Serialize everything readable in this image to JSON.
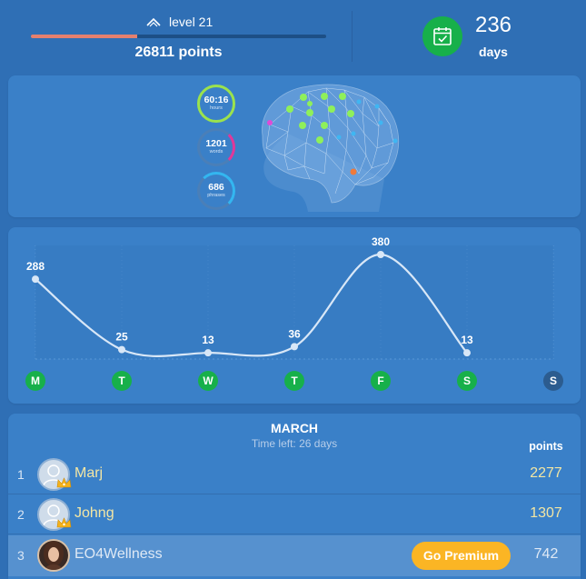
{
  "header": {
    "level_label": "level 21",
    "level_progress_percent": 36,
    "points_label": "26811 points",
    "streak_value": "236",
    "streak_unit": "days"
  },
  "brain_stats": [
    {
      "value": "60:16",
      "unit": "hours"
    },
    {
      "value": "1201",
      "unit": "words"
    },
    {
      "value": "686",
      "unit": "phrases"
    }
  ],
  "colors": {
    "background": "#2f6fb5",
    "card": "#3a80c8",
    "progress_fill": "#e5806f",
    "active_day": "#17b04a",
    "inactive_day": "#2c5c8f",
    "highlight_text": "#f3e6a4",
    "premium": "#fbb524"
  },
  "icons": {
    "level": "chevron-up-icon",
    "streak": "calendar-check-icon",
    "user_badge": "crown-icon",
    "avatar": "user-avatar-icon"
  },
  "chart_data": {
    "type": "line",
    "categories": [
      "M",
      "T",
      "W",
      "T",
      "F",
      "S",
      "S"
    ],
    "values": [
      288,
      25,
      13,
      36,
      380,
      13,
      null
    ],
    "value_labels": [
      "288",
      "25",
      "13",
      "36",
      "380",
      "13",
      ""
    ],
    "day_active": [
      true,
      true,
      true,
      true,
      true,
      true,
      false
    ],
    "title": "",
    "xlabel": "",
    "ylabel": "",
    "ylim": [
      0,
      380
    ],
    "grid": true
  },
  "leaderboard": {
    "month": "MARCH",
    "time_left": "Time left: 26 days",
    "column_label": "points",
    "premium_label": "Go Premium",
    "rows": [
      {
        "rank": "1",
        "name": "Marj",
        "score": "2277"
      },
      {
        "rank": "2",
        "name": "Johng",
        "score": "1307"
      },
      {
        "rank": "3",
        "name": "EO4Wellness",
        "score": "742"
      }
    ]
  }
}
